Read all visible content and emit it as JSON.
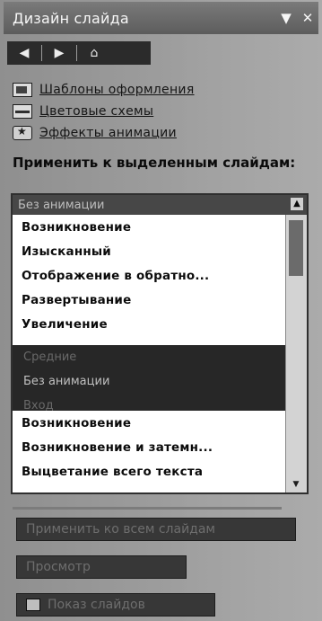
{
  "title": "Дизайн слайда",
  "title_controls": [
    "▼",
    "✕"
  ],
  "nav": {
    "back_icon": "back-arrow-icon",
    "forward_icon": "forward-arrow-icon",
    "home_icon": "home-icon"
  },
  "links": [
    {
      "label": "Шаблоны оформления",
      "icon": "templates-icon"
    },
    {
      "label": "Цветовые схемы",
      "icon": "color-schemes-icon"
    },
    {
      "label": "Эффекты анимации",
      "icon": "animation-effects-icon"
    }
  ],
  "apply_label": "Применить к выделенным слайдам:",
  "list": {
    "header": "Без анимации",
    "group_a": [
      "Возникновение",
      "Изысканный",
      "Отображение в обратно...",
      "Развертывание",
      "Увеличение"
    ],
    "categories": [
      "Средние",
      "Без анимации"
    ],
    "category_below": "Вход",
    "group_b": [
      "Возникновение",
      "Возникновение и затемн...",
      "Выцветание всего текста"
    ]
  },
  "buttons": [
    {
      "label": "Применить ко всем слайдам"
    },
    {
      "label": "Просмотр"
    },
    {
      "label": "Показ слайдов"
    }
  ]
}
